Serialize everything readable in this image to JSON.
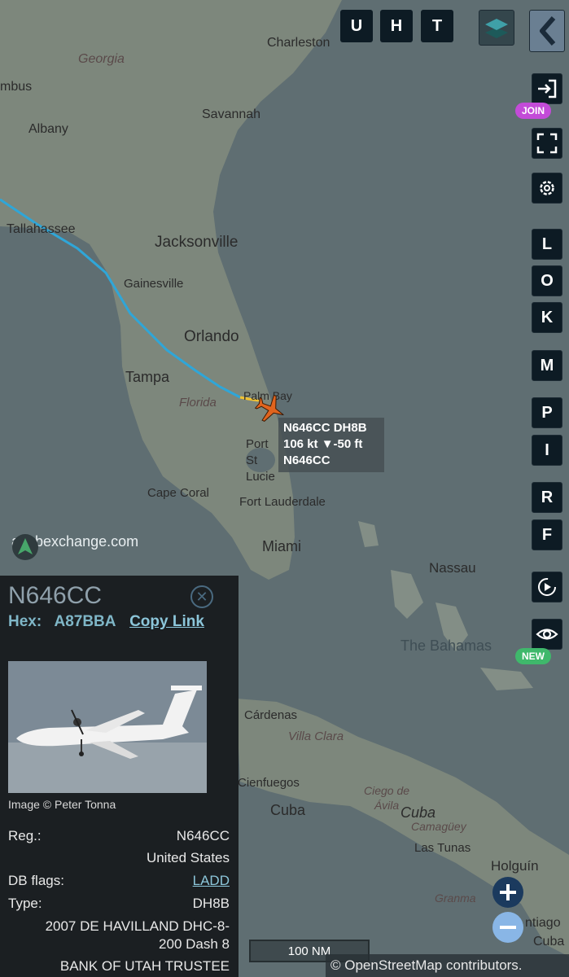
{
  "map": {
    "places": {
      "charleston": "Charleston",
      "georgia": "Georgia",
      "columbus": "mbus",
      "albany": "Albany",
      "savannah": "Savannah",
      "tallahassee": "Tallahassee",
      "jacksonville": "Jacksonville",
      "gainesville": "Gainesville",
      "orlando": "Orlando",
      "tampa": "Tampa",
      "florida": "Florida",
      "palm_bay": "Palm Bay",
      "port_st_lucie": "Port St Lucie",
      "cape_coral": "Cape Coral",
      "fort_lauderdale": "Fort Lauderdale",
      "miami": "Miami",
      "nassau": "Nassau",
      "bahamas": "The Bahamas",
      "cardenas": "Cárdenas",
      "villa_clara": "Villa Clara",
      "cienfuegos": "Cienfuegos",
      "cuba_1": "Cuba",
      "ciego_de_avila": "Ciego de Ávila",
      "cuba_2": "Cuba",
      "camaguey": "Camagüey",
      "las_tunas": "Las Tunas",
      "holguin": "Holguín",
      "granma": "Granma",
      "santiago": "ntiago",
      "cuba_3": "Cuba"
    },
    "brand": "adsbexchange.com",
    "scale": "100 NM",
    "attribution": "© OpenStreetMap contributors."
  },
  "toolbar": {
    "top_letters": [
      "U",
      "H",
      "T"
    ],
    "join_badge": "JOIN",
    "new_badge": "NEW",
    "letters": [
      "L",
      "O",
      "K",
      "M",
      "P",
      "I",
      "R",
      "F"
    ],
    "icons": [
      "login-icon",
      "fullscreen-icon",
      "settings-icon",
      "replay-icon",
      "eye-icon",
      "layers-icon",
      "back-icon"
    ]
  },
  "aircraft_label": {
    "line1": "N646CC DH8B",
    "line2": "106 kt  ▼-50 ft",
    "line3": "N646CC"
  },
  "panel": {
    "title": "N646CC",
    "hex_label": "Hex:",
    "hex_value": "A87BBA",
    "copy_link": "Copy Link",
    "image_credit": "Image © Peter Tonna",
    "reg_label": "Reg.:",
    "reg_value": "N646CC",
    "country": "United States",
    "db_flags_label": "DB flags:",
    "db_flags_value": "LADD",
    "type_label": "Type:",
    "type_value": "DH8B",
    "type_desc_1": "2007 DE HAVILLAND DHC-8-",
    "type_desc_2": "200 Dash 8",
    "owner": "BANK OF UTAH TRUSTEE"
  },
  "colors": {
    "sea": "#5f6e72",
    "land": "#7f8a80",
    "toolbar_bg": "#0d1b24",
    "join": "#c34bd8",
    "new": "#3fb86b",
    "aircraft": "#e0641e",
    "track": "#2fa6d8",
    "zoom_in": "#1b3a5e",
    "zoom_out": "#89b6e6"
  }
}
